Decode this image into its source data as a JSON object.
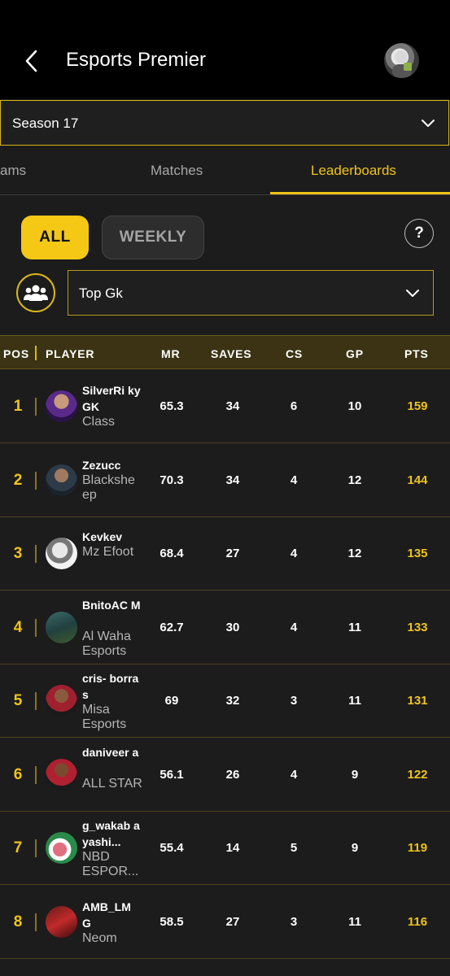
{
  "header": {
    "title": "Esports Premier",
    "back_icon": "chevron-left-icon"
  },
  "season": {
    "selected": "Season 17"
  },
  "tabs": [
    {
      "label": "ams",
      "active": false
    },
    {
      "label": "Matches",
      "active": false
    },
    {
      "label": "Leaderboards",
      "active": true
    }
  ],
  "period_filter": {
    "all_label": "ALL",
    "weekly_label": "WEEKLY",
    "selected": "ALL",
    "help_label": "?"
  },
  "category": {
    "selected": "Top Gk",
    "icon": "group-icon"
  },
  "table": {
    "columns": [
      "POS",
      "PLAYER",
      "MR",
      "SAVES",
      "CS",
      "GP",
      "PTS"
    ],
    "rows": [
      {
        "pos": "1",
        "name": "SilverRi kyGK",
        "team": "Class",
        "mr": "65.3",
        "saves": "34",
        "cs": "6",
        "gp": "10",
        "pts": "159"
      },
      {
        "pos": "2",
        "name": "Zezucc",
        "team": "Blackshe ep",
        "mr": "70.3",
        "saves": "34",
        "cs": "4",
        "gp": "12",
        "pts": "144"
      },
      {
        "pos": "3",
        "name": "Kevkev",
        "team": "Mz Efoot",
        "mr": "68.4",
        "saves": "27",
        "cs": "4",
        "gp": "12",
        "pts": "135"
      },
      {
        "pos": "4",
        "name": "BnitoAC M",
        "team": "Al Waha Esports",
        "mr": "62.7",
        "saves": "30",
        "cs": "4",
        "gp": "11",
        "pts": "133"
      },
      {
        "pos": "5",
        "name": "cris- borras",
        "team": "Misa Esports",
        "mr": "69",
        "saves": "32",
        "cs": "3",
        "gp": "11",
        "pts": "131"
      },
      {
        "pos": "6",
        "name": "daniveer a",
        "team": "ALL STAR",
        "mr": "56.1",
        "saves": "26",
        "cs": "4",
        "gp": "9",
        "pts": "122"
      },
      {
        "pos": "7",
        "name": "g_wakab ayashi...",
        "team": "NBD ESPOR...",
        "mr": "55.4",
        "saves": "14",
        "cs": "5",
        "gp": "9",
        "pts": "119"
      },
      {
        "pos": "8",
        "name": "AMB_LM G",
        "team": "Neom",
        "mr": "58.5",
        "saves": "27",
        "cs": "3",
        "gp": "11",
        "pts": "116"
      }
    ]
  },
  "colors": {
    "accent": "#f0c419",
    "background": "#1c1c1c",
    "header_row": "#3b3313"
  }
}
